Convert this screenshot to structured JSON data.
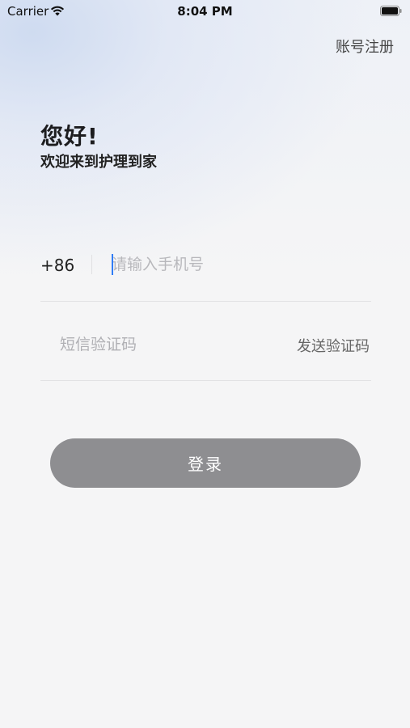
{
  "status_bar": {
    "carrier": "Carrier",
    "time": "8:04 PM"
  },
  "header": {
    "register_label": "账号注册"
  },
  "greeting": {
    "title": "您好!",
    "subtitle": "欢迎来到护理到家"
  },
  "phone": {
    "country_code": "+86",
    "placeholder": "请输入手机号",
    "value": ""
  },
  "sms": {
    "placeholder": "短信验证码",
    "value": "",
    "send_label": "发送验证码"
  },
  "login": {
    "label": "登录"
  },
  "colors": {
    "accent_caret": "#2f7cf6",
    "button_disabled": "#8e8e91"
  }
}
